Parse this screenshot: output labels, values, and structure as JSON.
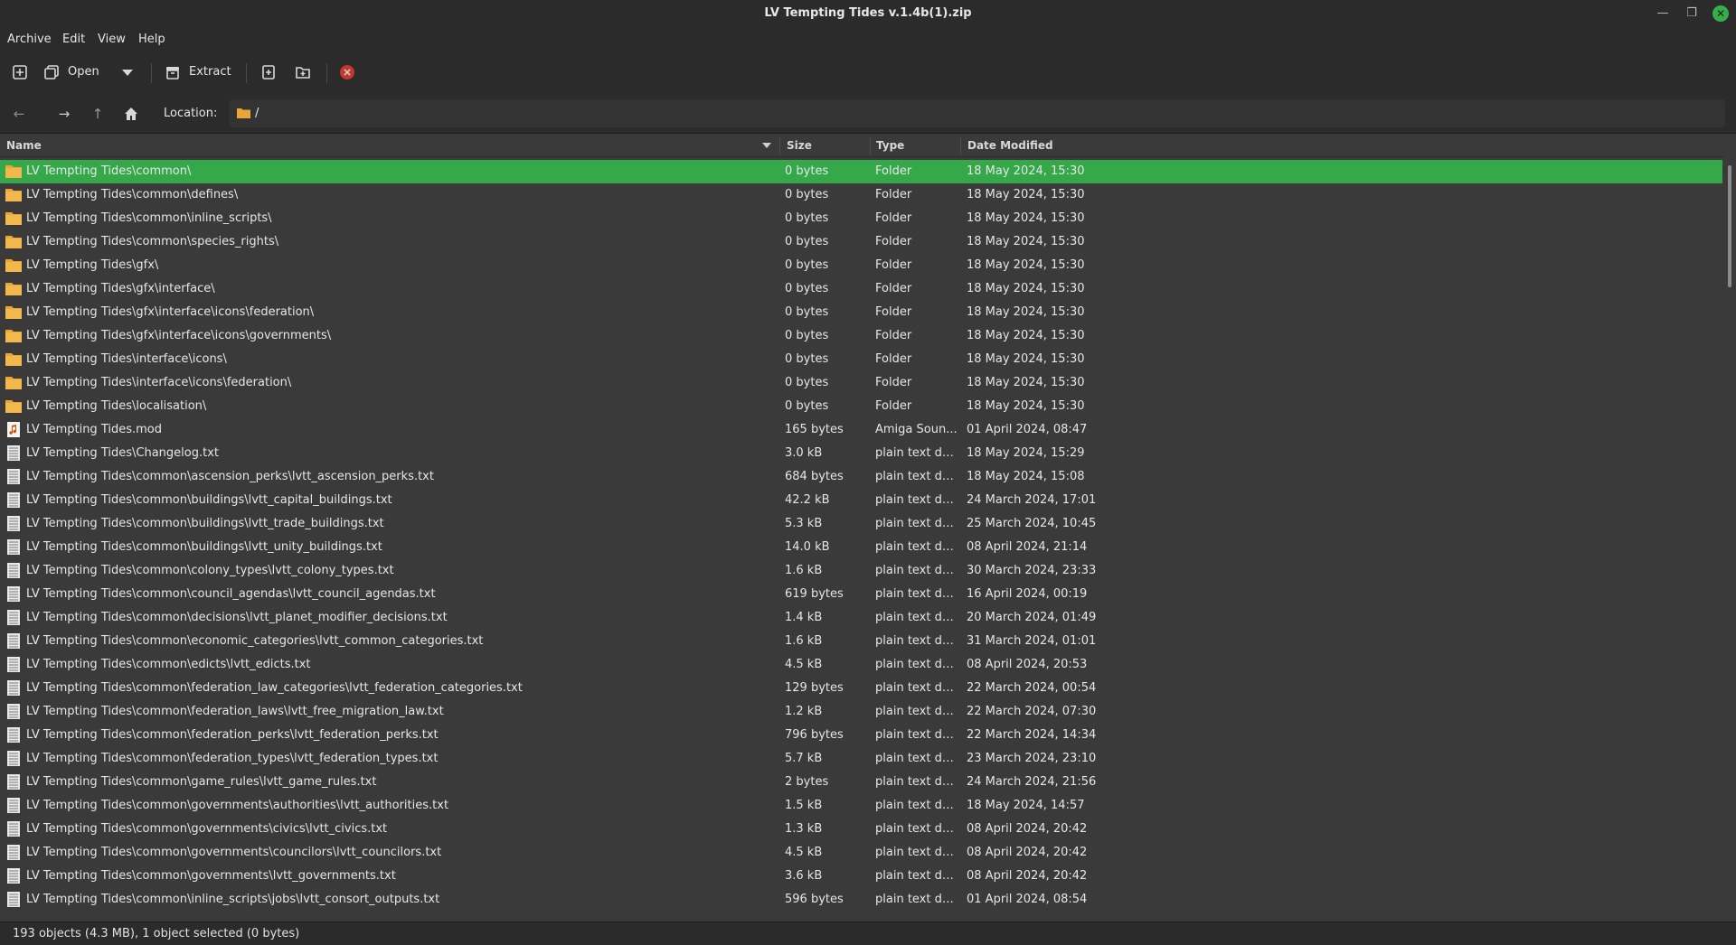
{
  "window": {
    "title": "LV Tempting Tides v.1.4b(1).zip"
  },
  "menu": [
    "Archive",
    "Edit",
    "View",
    "Help"
  ],
  "toolbar": {
    "open_label": "Open",
    "extract_label": "Extract"
  },
  "location": {
    "label": "Location:",
    "path": "/"
  },
  "columns": {
    "name": "Name",
    "size": "Size",
    "type": "Type",
    "date": "Date Modified"
  },
  "rows": [
    {
      "name": "LV Tempting Tides\\common\\",
      "size": "0 bytes",
      "type": "Folder",
      "date": "18 May 2024, 15:30",
      "icon": "folder-icon",
      "selected": true
    },
    {
      "name": "LV Tempting Tides\\common\\defines\\",
      "size": "0 bytes",
      "type": "Folder",
      "date": "18 May 2024, 15:30",
      "icon": "folder-icon"
    },
    {
      "name": "LV Tempting Tides\\common\\inline_scripts\\",
      "size": "0 bytes",
      "type": "Folder",
      "date": "18 May 2024, 15:30",
      "icon": "folder-icon"
    },
    {
      "name": "LV Tempting Tides\\common\\species_rights\\",
      "size": "0 bytes",
      "type": "Folder",
      "date": "18 May 2024, 15:30",
      "icon": "folder-icon"
    },
    {
      "name": "LV Tempting Tides\\gfx\\",
      "size": "0 bytes",
      "type": "Folder",
      "date": "18 May 2024, 15:30",
      "icon": "folder-icon"
    },
    {
      "name": "LV Tempting Tides\\gfx\\interface\\",
      "size": "0 bytes",
      "type": "Folder",
      "date": "18 May 2024, 15:30",
      "icon": "folder-icon"
    },
    {
      "name": "LV Tempting Tides\\gfx\\interface\\icons\\federation\\",
      "size": "0 bytes",
      "type": "Folder",
      "date": "18 May 2024, 15:30",
      "icon": "folder-icon"
    },
    {
      "name": "LV Tempting Tides\\gfx\\interface\\icons\\governments\\",
      "size": "0 bytes",
      "type": "Folder",
      "date": "18 May 2024, 15:30",
      "icon": "folder-icon"
    },
    {
      "name": "LV Tempting Tides\\interface\\icons\\",
      "size": "0 bytes",
      "type": "Folder",
      "date": "18 May 2024, 15:30",
      "icon": "folder-icon"
    },
    {
      "name": "LV Tempting Tides\\interface\\icons\\federation\\",
      "size": "0 bytes",
      "type": "Folder",
      "date": "18 May 2024, 15:30",
      "icon": "folder-icon"
    },
    {
      "name": "LV Tempting Tides\\localisation\\",
      "size": "0 bytes",
      "type": "Folder",
      "date": "18 May 2024, 15:30",
      "icon": "folder-icon"
    },
    {
      "name": "LV Tempting Tides.mod",
      "size": "165 bytes",
      "type": "Amiga Soun...",
      "date": "01 April 2024, 08:47",
      "icon": "audio-file-icon"
    },
    {
      "name": "LV Tempting Tides\\Changelog.txt",
      "size": "3.0 kB",
      "type": "plain text do...",
      "date": "18 May 2024, 15:29",
      "icon": "text-file-icon"
    },
    {
      "name": "LV Tempting Tides\\common\\ascension_perks\\lvtt_ascension_perks.txt",
      "size": "684 bytes",
      "type": "plain text do...",
      "date": "18 May 2024, 15:08",
      "icon": "text-file-icon"
    },
    {
      "name": "LV Tempting Tides\\common\\buildings\\lvtt_capital_buildings.txt",
      "size": "42.2 kB",
      "type": "plain text do...",
      "date": "24 March 2024, 17:01",
      "icon": "text-file-icon"
    },
    {
      "name": "LV Tempting Tides\\common\\buildings\\lvtt_trade_buildings.txt",
      "size": "5.3 kB",
      "type": "plain text do...",
      "date": "25 March 2024, 10:45",
      "icon": "text-file-icon"
    },
    {
      "name": "LV Tempting Tides\\common\\buildings\\lvtt_unity_buildings.txt",
      "size": "14.0 kB",
      "type": "plain text do...",
      "date": "08 April 2024, 21:14",
      "icon": "text-file-icon"
    },
    {
      "name": "LV Tempting Tides\\common\\colony_types\\lvtt_colony_types.txt",
      "size": "1.6 kB",
      "type": "plain text do...",
      "date": "30 March 2024, 23:33",
      "icon": "text-file-icon"
    },
    {
      "name": "LV Tempting Tides\\common\\council_agendas\\lvtt_council_agendas.txt",
      "size": "619 bytes",
      "type": "plain text do...",
      "date": "16 April 2024, 00:19",
      "icon": "text-file-icon"
    },
    {
      "name": "LV Tempting Tides\\common\\decisions\\lvtt_planet_modifier_decisions.txt",
      "size": "1.4 kB",
      "type": "plain text do...",
      "date": "20 March 2024, 01:49",
      "icon": "text-file-icon"
    },
    {
      "name": "LV Tempting Tides\\common\\economic_categories\\lvtt_common_categories.txt",
      "size": "1.6 kB",
      "type": "plain text do...",
      "date": "31 March 2024, 01:01",
      "icon": "text-file-icon"
    },
    {
      "name": "LV Tempting Tides\\common\\edicts\\lvtt_edicts.txt",
      "size": "4.5 kB",
      "type": "plain text do...",
      "date": "08 April 2024, 20:53",
      "icon": "text-file-icon"
    },
    {
      "name": "LV Tempting Tides\\common\\federation_law_categories\\lvtt_federation_categories.txt",
      "size": "129 bytes",
      "type": "plain text do...",
      "date": "22 March 2024, 00:54",
      "icon": "text-file-icon"
    },
    {
      "name": "LV Tempting Tides\\common\\federation_laws\\lvtt_free_migration_law.txt",
      "size": "1.2 kB",
      "type": "plain text do...",
      "date": "22 March 2024, 07:30",
      "icon": "text-file-icon"
    },
    {
      "name": "LV Tempting Tides\\common\\federation_perks\\lvtt_federation_perks.txt",
      "size": "796 bytes",
      "type": "plain text do...",
      "date": "22 March 2024, 14:34",
      "icon": "text-file-icon"
    },
    {
      "name": "LV Tempting Tides\\common\\federation_types\\lvtt_federation_types.txt",
      "size": "5.7 kB",
      "type": "plain text do...",
      "date": "23 March 2024, 23:10",
      "icon": "text-file-icon"
    },
    {
      "name": "LV Tempting Tides\\common\\game_rules\\lvtt_game_rules.txt",
      "size": "2 bytes",
      "type": "plain text do...",
      "date": "24 March 2024, 21:56",
      "icon": "text-file-icon"
    },
    {
      "name": "LV Tempting Tides\\common\\governments\\authorities\\lvtt_authorities.txt",
      "size": "1.5 kB",
      "type": "plain text do...",
      "date": "18 May 2024, 14:57",
      "icon": "text-file-icon"
    },
    {
      "name": "LV Tempting Tides\\common\\governments\\civics\\lvtt_civics.txt",
      "size": "1.3 kB",
      "type": "plain text do...",
      "date": "08 April 2024, 20:42",
      "icon": "text-file-icon"
    },
    {
      "name": "LV Tempting Tides\\common\\governments\\councilors\\lvtt_councilors.txt",
      "size": "4.5 kB",
      "type": "plain text do...",
      "date": "08 April 2024, 20:42",
      "icon": "text-file-icon"
    },
    {
      "name": "LV Tempting Tides\\common\\governments\\lvtt_governments.txt",
      "size": "3.6 kB",
      "type": "plain text do...",
      "date": "08 April 2024, 20:42",
      "icon": "text-file-icon"
    },
    {
      "name": "LV Tempting Tides\\common\\inline_scripts\\jobs\\lvtt_consort_outputs.txt",
      "size": "596 bytes",
      "type": "plain text do...",
      "date": "01 April 2024, 08:54",
      "icon": "text-file-icon"
    }
  ],
  "status": {
    "text": "193 objects (4.3 MB), 1 object selected (0 bytes)"
  },
  "colors": {
    "selection": "#35a84a",
    "folder": "#e8a838",
    "background": "#3a3a3a",
    "chrome": "#2b2b2b"
  }
}
